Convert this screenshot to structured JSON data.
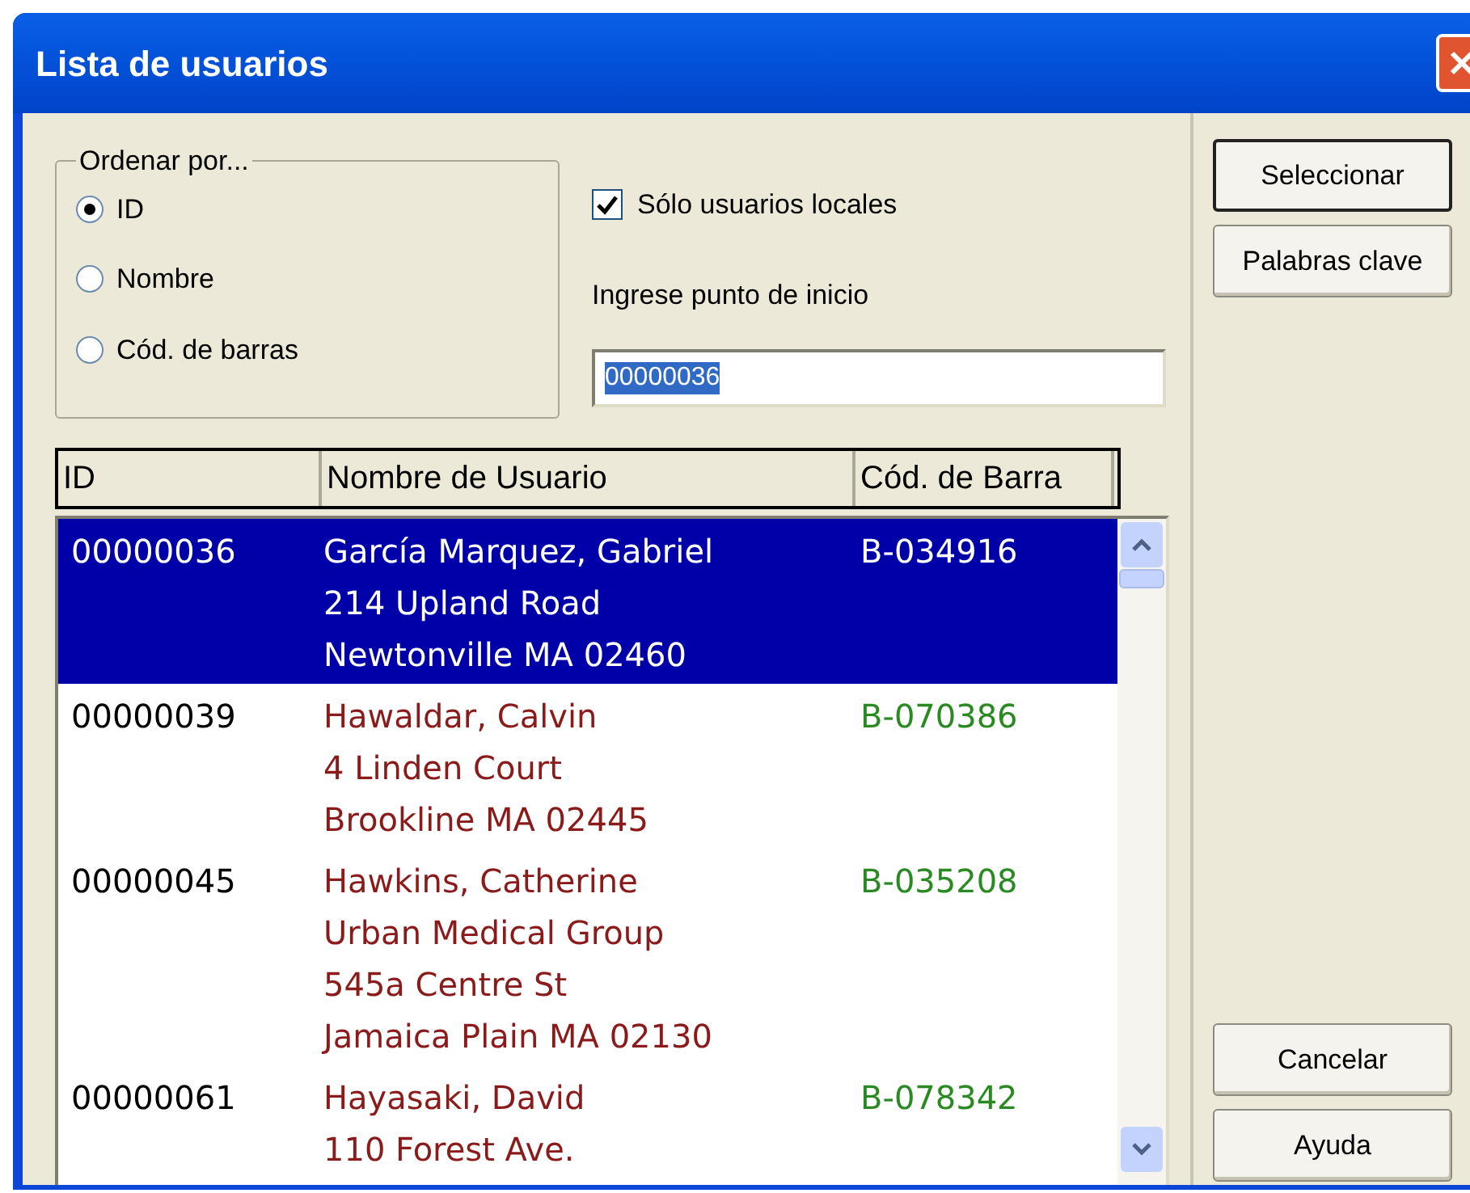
{
  "window": {
    "title": "Lista de usuarios"
  },
  "sort_group": {
    "title": "Ordenar por...",
    "options": [
      {
        "label": "ID",
        "selected": true
      },
      {
        "label": "Nombre",
        "selected": false
      },
      {
        "label": "Cód. de barras",
        "selected": false
      }
    ]
  },
  "local_only": {
    "label": "Sólo usuarios locales",
    "checked": true
  },
  "start_point": {
    "label": "Ingrese punto de inicio",
    "value": "00000036"
  },
  "table": {
    "columns": [
      "ID",
      "Nombre de Usuario",
      "Cód. de Barra"
    ],
    "rows": [
      {
        "id": "00000036",
        "lines": [
          "García Marquez, Gabriel",
          "214 Upland Road",
          "Newtonville MA 02460"
        ],
        "barcode": "B-034916",
        "selected": true
      },
      {
        "id": "00000039",
        "lines": [
          "Hawaldar, Calvin",
          "4 Linden Court",
          "Brookline MA 02445"
        ],
        "barcode": "B-070386",
        "selected": false
      },
      {
        "id": "00000045",
        "lines": [
          "Hawkins, Catherine",
          "Urban Medical Group",
          "545a Centre St",
          "Jamaica Plain MA 02130"
        ],
        "barcode": "B-035208",
        "selected": false
      },
      {
        "id": "00000061",
        "lines": [
          "Hayasaki, David",
          "110 Forest Ave."
        ],
        "barcode": "B-078342",
        "selected": false
      }
    ]
  },
  "buttons_top": [
    "Seleccionar",
    "Palabras clave"
  ],
  "buttons_bottom": [
    "Cancelar",
    "Ayuda"
  ]
}
